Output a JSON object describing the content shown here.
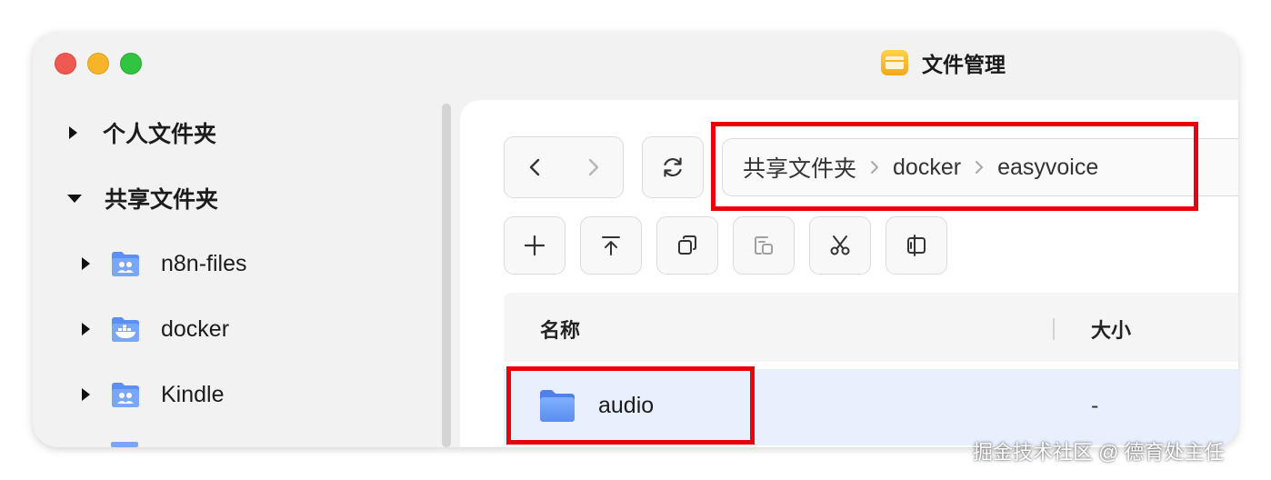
{
  "window": {
    "title": "文件管理",
    "colors": {
      "accent": "#4a7cf0",
      "highlight_box": "#e8000b",
      "row_selected": "#e8effd"
    }
  },
  "sidebar": {
    "items": [
      {
        "label": "个人文件夹",
        "expanded": false,
        "icon": "none"
      },
      {
        "label": "共享文件夹",
        "expanded": true,
        "icon": "none"
      },
      {
        "label": "n8n-files",
        "expanded": false,
        "icon": "shared-folder-icon"
      },
      {
        "label": "docker",
        "expanded": false,
        "icon": "docker-folder-icon"
      },
      {
        "label": "Kindle",
        "expanded": false,
        "icon": "shared-folder-icon"
      }
    ]
  },
  "toolbar": {
    "back_icon": "chevron-left-icon",
    "forward_icon": "chevron-right-icon",
    "refresh_icon": "refresh-icon",
    "actions": [
      "add-icon",
      "upload-icon",
      "copy-icon",
      "paste-icon",
      "cut-icon",
      "move-icon"
    ]
  },
  "breadcrumb": {
    "items": [
      "共享文件夹",
      "docker",
      "easyvoice"
    ]
  },
  "table": {
    "columns": [
      "名称",
      "大小"
    ],
    "rows": [
      {
        "name": "audio",
        "size": "-",
        "icon": "folder-icon"
      }
    ]
  },
  "watermark": "掘金技术社区 @ 德育处主任"
}
